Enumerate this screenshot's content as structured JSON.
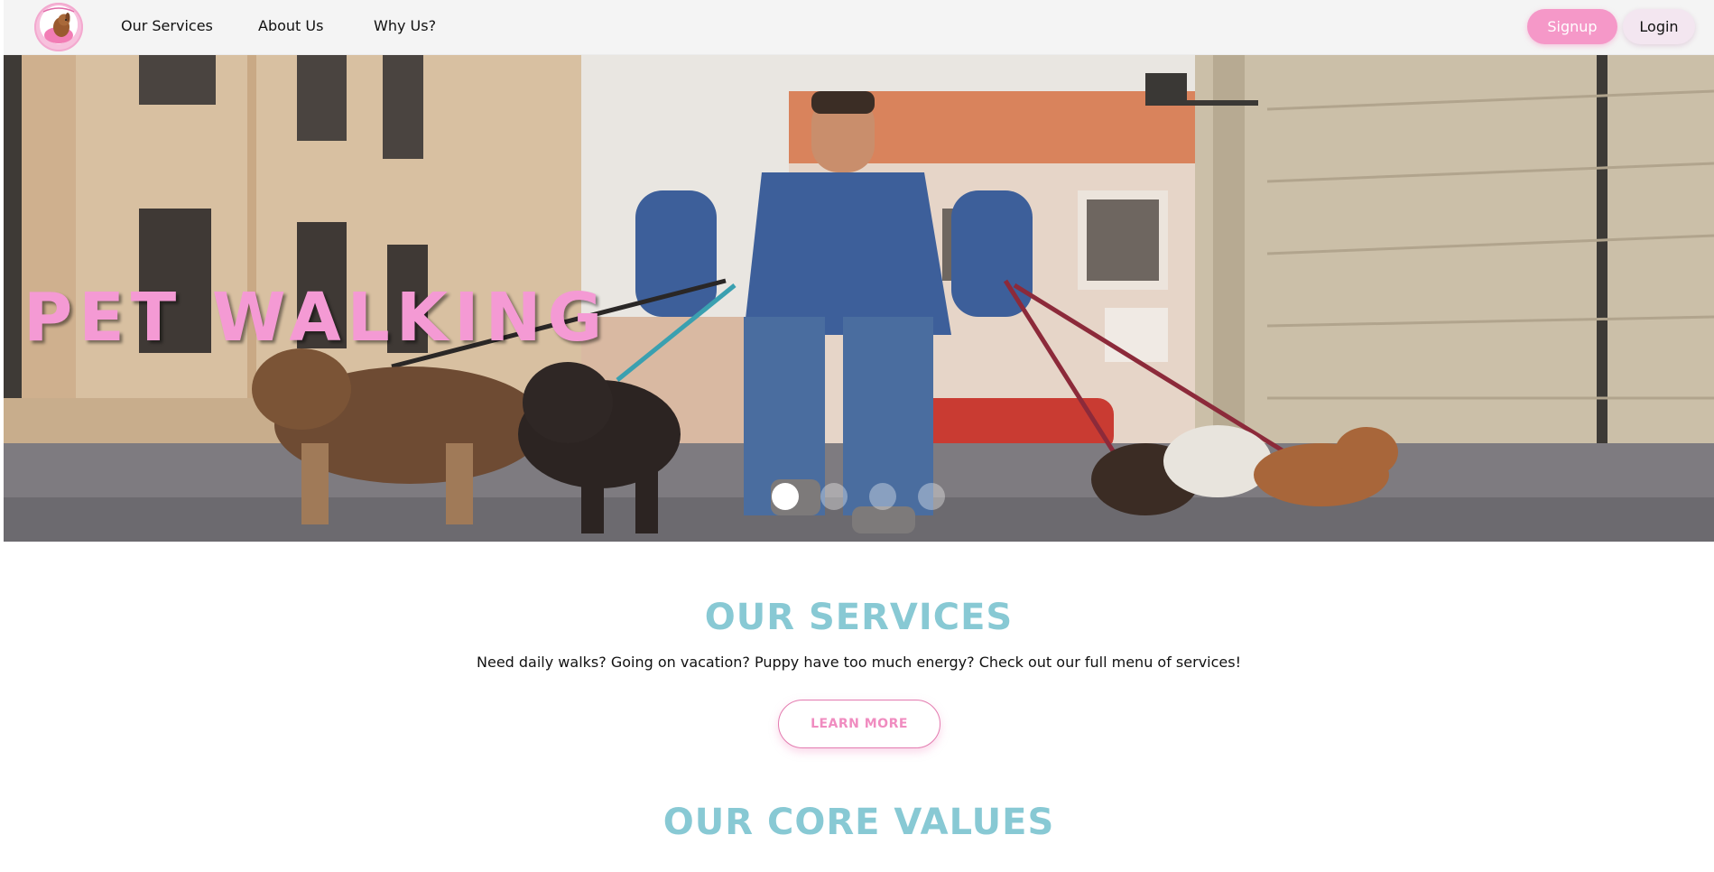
{
  "nav": {
    "logo_name": "pet-logo",
    "links": [
      "Our Services",
      "About Us",
      "Why Us?"
    ],
    "signup_label": "Signup",
    "login_label": "Login"
  },
  "hero": {
    "title": "PET WALKING",
    "slides_total": 4,
    "active_slide_index": 0
  },
  "services": {
    "heading": "OUR SERVICES",
    "text": "Need daily walks? Going on vacation? Puppy have too much energy? Check out our full menu of services!",
    "cta": "LEARN MORE"
  },
  "values": {
    "heading": "OUR CORE VALUES"
  },
  "colors": {
    "accent_pink": "#f598c8",
    "heading_teal": "#88c9d4"
  }
}
